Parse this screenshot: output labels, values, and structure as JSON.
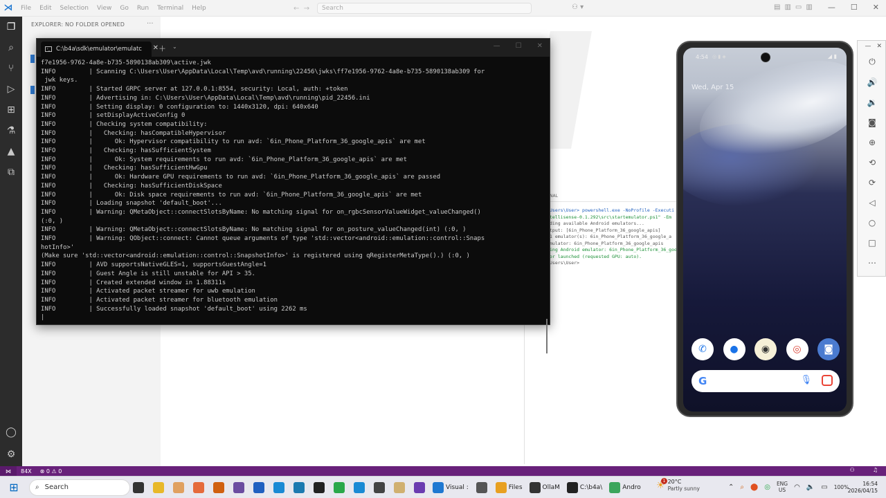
{
  "vscode": {
    "menu": [
      "File",
      "Edit",
      "Selection",
      "View",
      "Go",
      "Run",
      "Terminal",
      "Help"
    ],
    "search_placeholder": "Search",
    "explorer_title": "EXPLORER: NO FOLDER OPENED",
    "explorer_more": "···",
    "status": {
      "ports": "84X",
      "problems": "⊗ 0 ⚠ 0"
    },
    "panel": {
      "tab_label": "NAL",
      "lines": [
        "Users\\User> powershell.exe -NoProfile -Executi",
        "tellisense-0.1.292\\src\\startemulator.ps1\" -Em",
        "ding available Android emulators...",
        "tput: [6in_Phone_Platform_36_google_apis]",
        "1 emulator(s): 6in_Phone_Platform_36_google_a",
        "mulator: 6in_Phone_Platform_36_google_apis",
        "",
        "ing Android emulator: 6in_Phone_Platform_36_goo",
        "or launched (requested GPU: auto).",
        "Users\\User>"
      ]
    }
  },
  "terminal": {
    "tab_title": "C:\\b4a\\sdk\\emulator\\emulatc",
    "lines": [
      "f7e1956-9762-4a8e-b735-5890138ab309\\active.jwk",
      "INFO         | Scanning C:\\Users\\User\\AppData\\Local\\Temp\\avd\\running\\22456\\jwks\\ff7e1956-9762-4a8e-b735-5890138ab309 for",
      " jwk keys.",
      "INFO         | Started GRPC server at 127.0.0.1:8554, security: Local, auth: +token",
      "INFO         | Advertising in: C:\\Users\\User\\AppData\\Local\\Temp\\avd\\running\\pid_22456.ini",
      "INFO         | Setting display: 0 configuration to: 1440x3120, dpi: 640x640",
      "INFO         | setDisplayActiveConfig 0",
      "INFO         | Checking system compatibility:",
      "INFO         |   Checking: hasCompatibleHypervisor",
      "INFO         |      Ok: Hypervisor compatibility to run avd: `6in_Phone_Platform_36_google_apis` are met",
      "INFO         |   Checking: hasSufficientSystem",
      "INFO         |      Ok: System requirements to run avd: `6in_Phone_Platform_36_google_apis` are met",
      "INFO         |   Checking: hasSufficientHwGpu",
      "INFO         |      Ok: Hardware GPU requirements to run avd: `6in_Phone_Platform_36_google_apis` are passed",
      "INFO         |   Checking: hasSufficientDiskSpace",
      "INFO         |      Ok: Disk space requirements to run avd: `6in_Phone_Platform_36_google_apis` are met",
      "INFO         | Loading snapshot 'default_boot'...",
      "INFO         | Warning: QMetaObject::connectSlotsByName: No matching signal for on_rgbcSensorValueWidget_valueChanged()",
      "(:0, )",
      "INFO         | Warning: QMetaObject::connectSlotsByName: No matching signal for on_posture_valueChanged(int) (:0, )",
      "INFO         | Warning: QObject::connect: Cannot queue arguments of type 'std::vector<android::emulation::control::Snaps",
      "hotInfo>'",
      "(Make sure 'std::vector<android::emulation::control::SnapshotInfo>' is registered using qRegisterMetaType().) (:0, )",
      "INFO         | AVD supportsNativeGLES=1, supportsGuestAngle=1",
      "INFO         | Guest Angle is still unstable for API > 35.",
      "INFO         | Created extended window in 1.88311s",
      "INFO         | Activated packet streamer for uwb emulation",
      "INFO         | Activated packet streamer for bluetooth emulation",
      "INFO         | Successfully loaded snapshot 'default_boot' using 2262 ms",
      "|"
    ]
  },
  "phone": {
    "time": "4:54",
    "date": "Wed, Apr 15",
    "dock_apps": [
      {
        "name": "phone-app-icon",
        "glyph": "✆",
        "bg": "#ffffff",
        "fg": "#1a73e8"
      },
      {
        "name": "messages-app-icon",
        "glyph": "●",
        "bg": "#ffffff",
        "fg": "#1a73e8"
      },
      {
        "name": "gallery-app-icon",
        "glyph": "◉",
        "bg": "#f6f0d8",
        "fg": "#333333"
      },
      {
        "name": "chrome-app-icon",
        "glyph": "◎",
        "bg": "#ffffff",
        "fg": "#db4437"
      },
      {
        "name": "camera-app-icon",
        "glyph": "◙",
        "bg": "#4a7bd0",
        "fg": "#ffffff"
      }
    ]
  },
  "taskbar": {
    "search_label": "Search",
    "apps": [
      {
        "name": "taskview-icon",
        "label": "",
        "color": "#333333"
      },
      {
        "name": "file-explorer-icon",
        "label": "",
        "color": "#e8b829"
      },
      {
        "name": "b4j-icon",
        "label": "",
        "color": "#e0a060"
      },
      {
        "name": "postman-icon",
        "label": "",
        "color": "#e56a3b"
      },
      {
        "name": "search-app-icon",
        "label": "",
        "color": "#d06010"
      },
      {
        "name": "obs-icon",
        "label": "",
        "color": "#6b4ca0"
      },
      {
        "name": "app-blue-icon",
        "label": "",
        "color": "#2060c0"
      },
      {
        "name": "edge-icon",
        "label": "",
        "color": "#1a8ad4"
      },
      {
        "name": "app-teal-icon",
        "label": "",
        "color": "#1c7ab0"
      },
      {
        "name": "terminal-icon",
        "label": "",
        "color": "#222222"
      },
      {
        "name": "chrome-taskbar-icon",
        "label": "",
        "color": "#2aa84a"
      },
      {
        "name": "app-cyan-icon",
        "label": "",
        "color": "#1a8ad4"
      },
      {
        "name": "snip-icon",
        "label": "",
        "color": "#444444"
      },
      {
        "name": "b4a-icon",
        "label": "",
        "color": "#d0b070"
      },
      {
        "name": "vs-purple-icon",
        "label": "",
        "color": "#6b3cb0"
      },
      {
        "name": "vscode-icon",
        "label": "Visual :",
        "color": "#1f78d1"
      },
      {
        "name": "robot-icon",
        "label": "",
        "color": "#555555"
      },
      {
        "name": "files-icon",
        "label": "Files",
        "color": "#e8a020"
      },
      {
        "name": "ollama-icon",
        "label": "OllaM",
        "color": "#333333"
      },
      {
        "name": "cmd-icon",
        "label": "C:\\b4a\\",
        "color": "#222222"
      },
      {
        "name": "android-studio-icon",
        "label": "Andro",
        "color": "#3ba55c"
      }
    ],
    "weather_temp": "20°C",
    "weather_desc": "Partly sunny",
    "notification_count": "1",
    "lang_top": "ENG",
    "lang_bottom": "US",
    "battery": "100%",
    "time": "16:54",
    "date": "2026/04/15"
  }
}
